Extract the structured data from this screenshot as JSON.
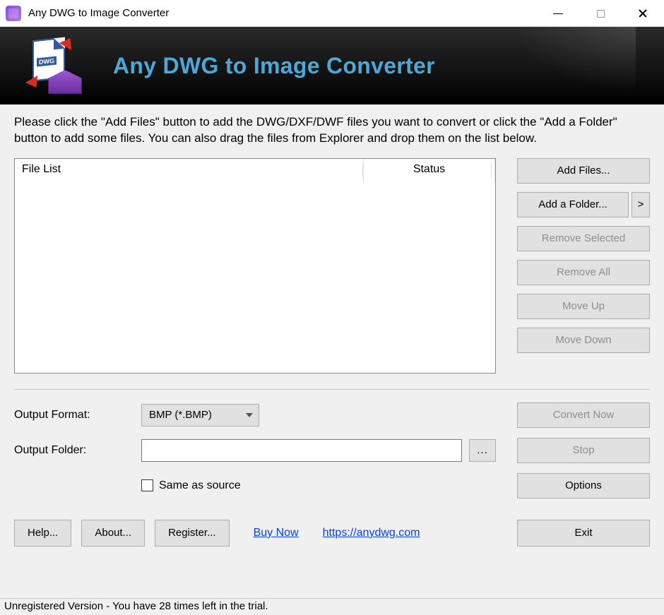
{
  "window": {
    "title": "Any DWG to Image Converter"
  },
  "banner": {
    "title": "Any DWG to Image Converter",
    "logo_tag": "DWG"
  },
  "instructions": "Please click the \"Add Files\" button to add the DWG/DXF/DWF files you want to convert or click the \"Add a Folder\" button to add some files. You can also drag the files from Explorer and drop them on the list below.",
  "file_list": {
    "columns": {
      "file": "File List",
      "status": "Status"
    }
  },
  "side_buttons": {
    "add_files": "Add Files...",
    "add_folder": "Add a Folder...",
    "add_folder_chevron": ">",
    "remove_selected": "Remove Selected",
    "remove_all": "Remove All",
    "move_up": "Move Up",
    "move_down": "Move Down"
  },
  "output": {
    "format_label": "Output Format:",
    "format_value": "BMP (*.BMP)",
    "folder_label": "Output Folder:",
    "folder_value": "",
    "browse": "...",
    "same_as_source": "Same as source"
  },
  "actions": {
    "convert_now": "Convert Now",
    "stop": "Stop",
    "options": "Options"
  },
  "bottom": {
    "help": "Help...",
    "about": "About...",
    "register": "Register...",
    "buy_now": "Buy Now",
    "site_url": "https://anydwg.com",
    "exit": "Exit"
  },
  "status": "Unregistered Version - You have 28 times left in the trial."
}
